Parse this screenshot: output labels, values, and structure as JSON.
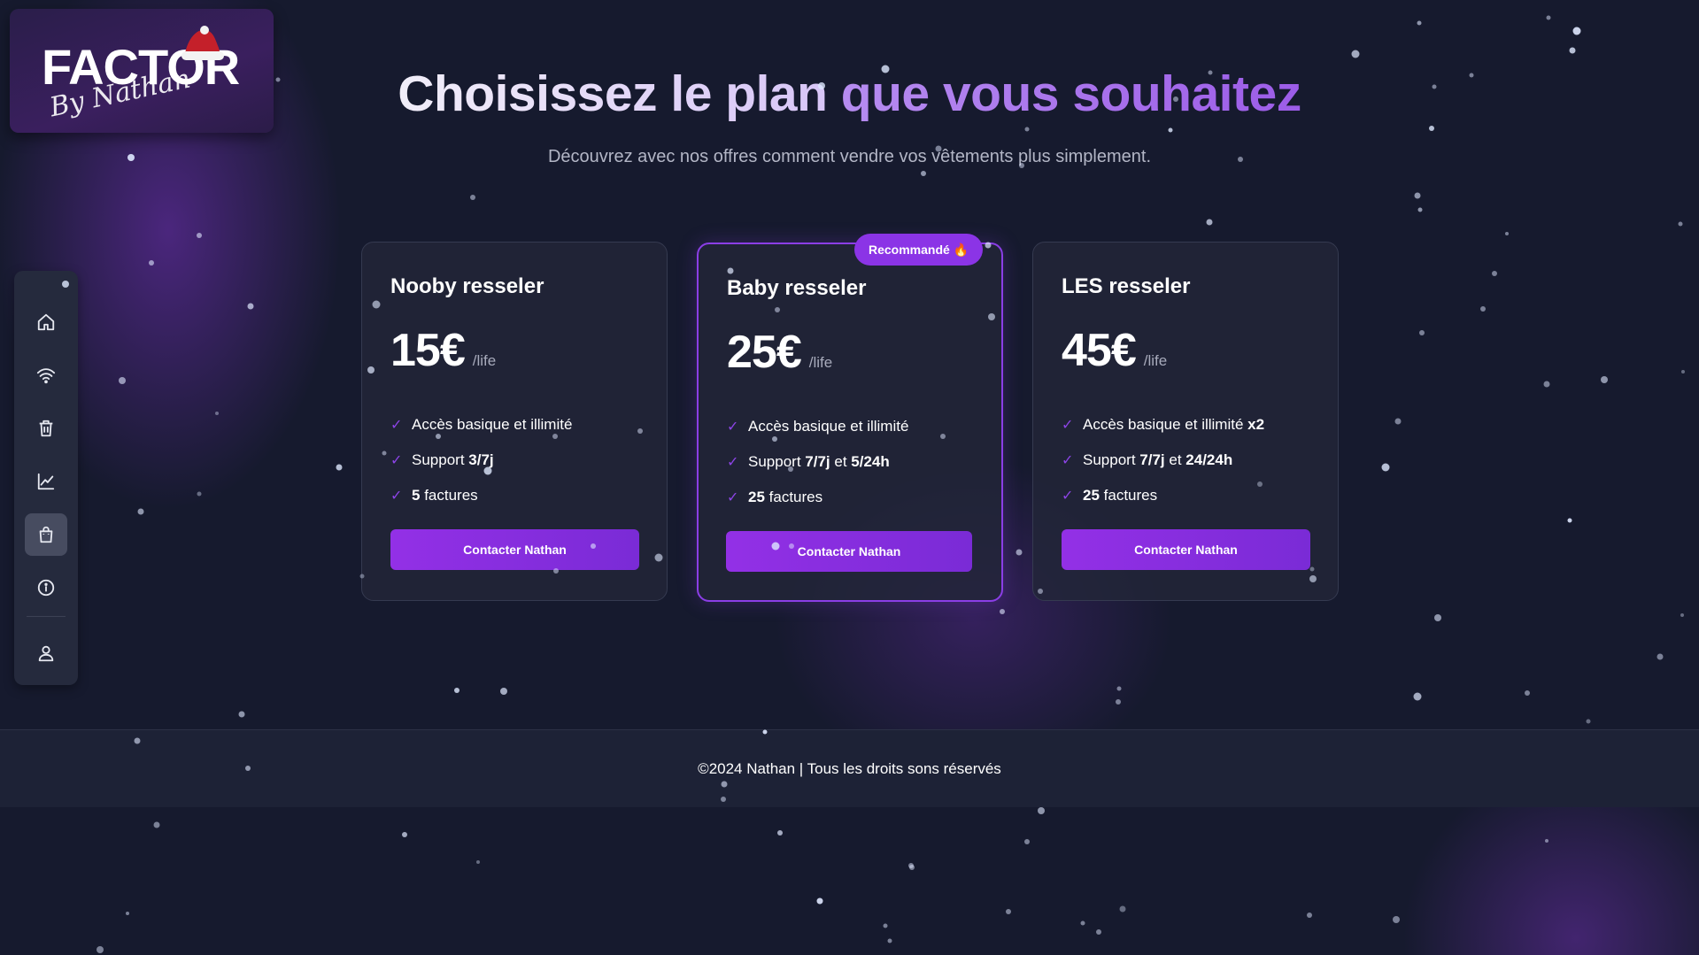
{
  "brand": {
    "logo_text": "FACTOR",
    "signature": "By Nathan"
  },
  "sidebar": {
    "items": [
      {
        "icon": "home-icon"
      },
      {
        "icon": "wifi-icon"
      },
      {
        "icon": "trash-icon"
      },
      {
        "icon": "chart-line-icon"
      },
      {
        "icon": "shopping-bag-icon",
        "active": true
      },
      {
        "icon": "info-icon"
      },
      {
        "icon": "user-icon"
      }
    ]
  },
  "header": {
    "title_part1": "Choisissez le plan ",
    "title_part2": "que vous souhaitez",
    "subtitle": "Découvrez avec nos offres comment vendre vos vêtements plus simplement."
  },
  "plans": [
    {
      "name": "Nooby resseler",
      "price": "15€",
      "period": "/life",
      "features": [
        {
          "text": "Accès basique et illimité",
          "bold": ""
        },
        {
          "text": "Support ",
          "bold": "3/7j"
        },
        {
          "text": "factures",
          "bold": "5"
        }
      ],
      "cta": "Contacter Nathan"
    },
    {
      "name": "Baby resseler",
      "price": "25€",
      "period": "/life",
      "badge": "Recommandé",
      "features": [
        {
          "text": "Accès basique et illimité",
          "bold": ""
        },
        {
          "text": "Support ",
          "bold": "7/7j",
          "mid": " et ",
          "bold2": "5/24h"
        },
        {
          "text": "factures",
          "bold": "25"
        }
      ],
      "cta": "Contacter Nathan"
    },
    {
      "name": "LES resseler",
      "price": "45€",
      "period": "/life",
      "features": [
        {
          "text": "Accès basique et illimité ",
          "bold": "x2"
        },
        {
          "text": "Support ",
          "bold": "7/7j",
          "mid": " et ",
          "bold2": "24/24h"
        },
        {
          "text": "factures",
          "bold": "25"
        }
      ],
      "cta": "Contacter Nathan"
    }
  ],
  "footer": {
    "text": "©2024 Nathan | Tous les droits sons réservés"
  },
  "colors": {
    "background": "#161a2e",
    "accent": "#8b34e6",
    "card": "#222638",
    "check": "#8c44e6"
  }
}
